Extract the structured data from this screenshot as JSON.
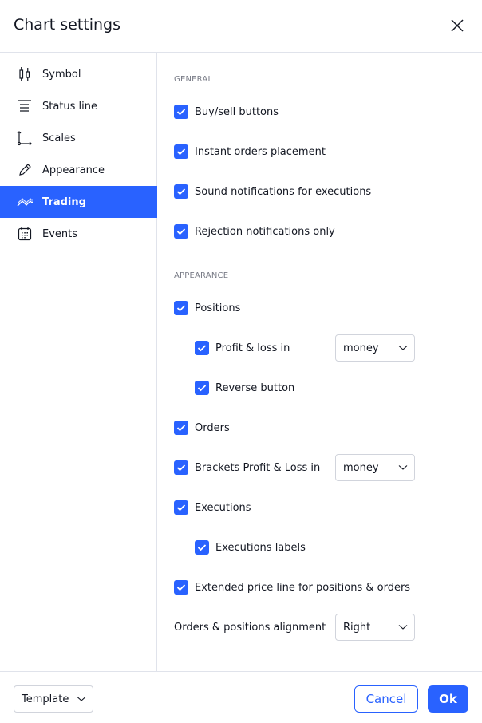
{
  "dialog": {
    "title": "Chart settings"
  },
  "sidebar": {
    "items": [
      {
        "label": "Symbol",
        "icon": "candlestick-icon"
      },
      {
        "label": "Status line",
        "icon": "status-line-icon"
      },
      {
        "label": "Scales",
        "icon": "scales-icon"
      },
      {
        "label": "Appearance",
        "icon": "pencil-icon"
      },
      {
        "label": "Trading",
        "icon": "trading-icon",
        "active": true
      },
      {
        "label": "Events",
        "icon": "calendar-icon"
      }
    ]
  },
  "sections": {
    "general": "GENERAL",
    "appearance": "APPEARANCE"
  },
  "options": {
    "buy_sell": {
      "label": "Buy/sell buttons",
      "checked": true
    },
    "instant_orders": {
      "label": "Instant orders placement",
      "checked": true
    },
    "sound": {
      "label": "Sound notifications for executions",
      "checked": true
    },
    "rejection": {
      "label": "Rejection notifications only",
      "checked": true
    },
    "positions": {
      "label": "Positions",
      "checked": true
    },
    "pnl": {
      "label": "Profit & loss in",
      "checked": true,
      "value": "money"
    },
    "reverse": {
      "label": "Reverse button",
      "checked": true
    },
    "orders": {
      "label": "Orders",
      "checked": true
    },
    "brackets": {
      "label": "Brackets Profit & Loss in",
      "checked": true,
      "value": "money"
    },
    "executions": {
      "label": "Executions",
      "checked": true
    },
    "exec_labels": {
      "label": "Executions labels",
      "checked": true
    },
    "extended": {
      "label": "Extended price line for positions & orders",
      "checked": true
    },
    "alignment": {
      "label": "Orders & positions alignment",
      "value": "Right"
    }
  },
  "footer": {
    "template": "Template",
    "cancel": "Cancel",
    "ok": "Ok"
  },
  "colors": {
    "accent": "#2962ff"
  }
}
